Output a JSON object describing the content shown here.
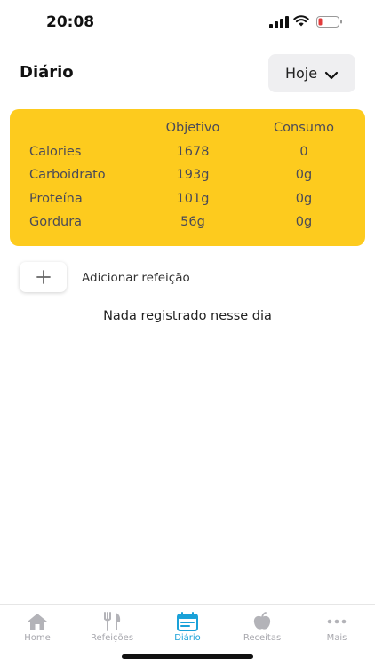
{
  "status": {
    "time": "20:08"
  },
  "header": {
    "title": "Diário",
    "date_label": "Hoje"
  },
  "nutrition": {
    "headers": {
      "objetivo": "Objetivo",
      "consumo": "Consumo"
    },
    "rows": [
      {
        "name": "Calories",
        "objetivo": "1678",
        "consumo": "0"
      },
      {
        "name": "Carboidrato",
        "objetivo": "193g",
        "consumo": "0g"
      },
      {
        "name": "Proteína",
        "objetivo": "101g",
        "consumo": "0g"
      },
      {
        "name": "Gordura",
        "objetivo": "56g",
        "consumo": "0g"
      }
    ]
  },
  "actions": {
    "add_meal_label": "Adicionar refeição"
  },
  "empty_message": "Nada registrado nesse dia",
  "tabs": [
    {
      "label": "Home",
      "icon": "home-icon"
    },
    {
      "label": "Refeições",
      "icon": "fork-knife-icon"
    },
    {
      "label": "Diário",
      "icon": "calendar-icon"
    },
    {
      "label": "Receitas",
      "icon": "apple-icon"
    },
    {
      "label": "Mais",
      "icon": "more-icon"
    }
  ],
  "colors": {
    "card": "#fdcb1e",
    "accent": "#1aa1d8",
    "battery_low": "#e23b3b"
  }
}
